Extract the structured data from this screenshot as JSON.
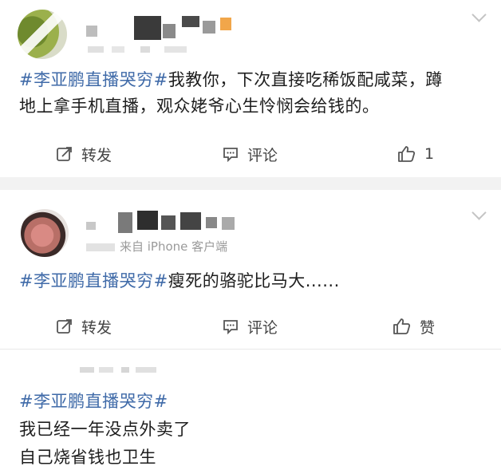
{
  "post1": {
    "hashtag": "#李亚鹏直播哭穷#",
    "text_line1": "我教你，下次直接吃稀饭配咸菜，蹲",
    "text_line2": "地上拿手机直播，观众姥爷心生怜悯会给钱的。",
    "actions": {
      "repost": "转发",
      "comment": "评论",
      "like_count": "1"
    }
  },
  "post2": {
    "source": "来自 iPhone 客户端",
    "hashtag": "#李亚鹏直播哭穷#",
    "text": "瘦死的骆驼比马大......",
    "actions": {
      "repost": "转发",
      "comment": "评论",
      "like": "赞"
    }
  },
  "post3": {
    "hashtag": "#李亚鹏直播哭穷#",
    "line1": "我已经一年没点外卖了",
    "line2": "自己烧省钱也卫生"
  },
  "colors": {
    "hashtag": "#3f6aa8",
    "divider": "#f2f2f2",
    "text": "#1e1e1e"
  },
  "icons": [
    "repost-icon",
    "comment-icon",
    "like-icon",
    "chevron-down-icon"
  ]
}
